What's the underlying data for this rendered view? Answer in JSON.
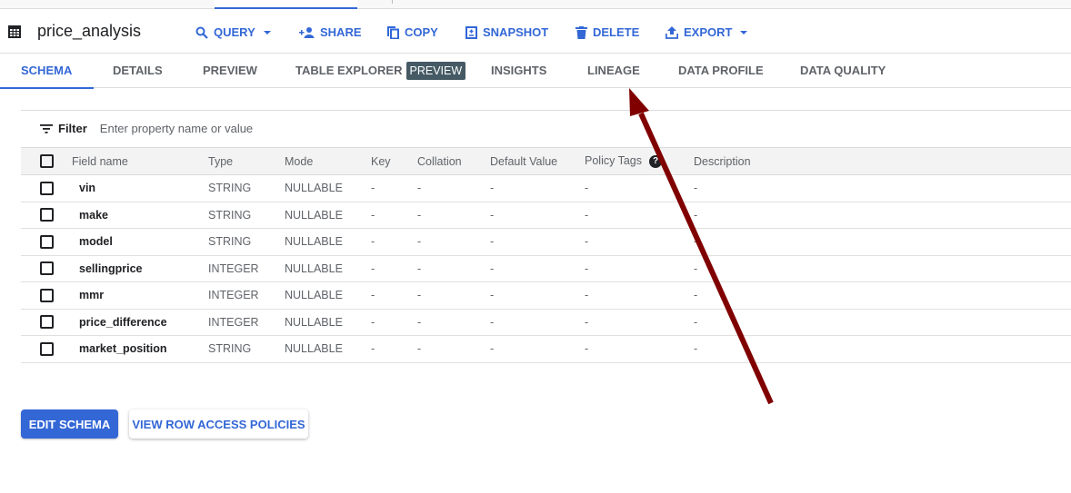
{
  "header": {
    "title": "price_analysis",
    "table_icon": "table-icon"
  },
  "toolbar": {
    "actions": [
      {
        "label": "QUERY",
        "icon": "search-icon",
        "dropdown": true
      },
      {
        "label": "SHARE",
        "icon": "person-add-icon",
        "dropdown": false
      },
      {
        "label": "COPY",
        "icon": "copy-icon",
        "dropdown": false
      },
      {
        "label": "SNAPSHOT",
        "icon": "snapshot-icon",
        "dropdown": false
      },
      {
        "label": "DELETE",
        "icon": "trash-icon",
        "dropdown": false
      },
      {
        "label": "EXPORT",
        "icon": "upload-icon",
        "dropdown": true
      }
    ]
  },
  "tabs": [
    {
      "label": "SCHEMA",
      "active": true
    },
    {
      "label": "DETAILS"
    },
    {
      "label": "PREVIEW"
    },
    {
      "label": "TABLE EXPLORER",
      "badge": "PREVIEW"
    },
    {
      "label": "INSIGHTS"
    },
    {
      "label": "LINEAGE"
    },
    {
      "label": "DATA PROFILE"
    },
    {
      "label": "DATA QUALITY"
    }
  ],
  "filter": {
    "label": "Filter",
    "placeholder": "Enter property name or value"
  },
  "schema_table": {
    "columns": [
      "Field name",
      "Type",
      "Mode",
      "Key",
      "Collation",
      "Default Value",
      "Policy Tags",
      "Description"
    ],
    "rows": [
      {
        "name": "vin",
        "type": "STRING",
        "mode": "NULLABLE",
        "key": "-",
        "collation": "-",
        "default": "-",
        "policy": "-",
        "description": "-"
      },
      {
        "name": "make",
        "type": "STRING",
        "mode": "NULLABLE",
        "key": "-",
        "collation": "-",
        "default": "-",
        "policy": "-",
        "description": "-"
      },
      {
        "name": "model",
        "type": "STRING",
        "mode": "NULLABLE",
        "key": "-",
        "collation": "-",
        "default": "-",
        "policy": "-",
        "description": "-"
      },
      {
        "name": "sellingprice",
        "type": "INTEGER",
        "mode": "NULLABLE",
        "key": "-",
        "collation": "-",
        "default": "-",
        "policy": "-",
        "description": "-"
      },
      {
        "name": "mmr",
        "type": "INTEGER",
        "mode": "NULLABLE",
        "key": "-",
        "collation": "-",
        "default": "-",
        "policy": "-",
        "description": "-"
      },
      {
        "name": "price_difference",
        "type": "INTEGER",
        "mode": "NULLABLE",
        "key": "-",
        "collation": "-",
        "default": "-",
        "policy": "-",
        "description": "-"
      },
      {
        "name": "market_position",
        "type": "STRING",
        "mode": "NULLABLE",
        "key": "-",
        "collation": "-",
        "default": "-",
        "policy": "-",
        "description": "-"
      }
    ]
  },
  "buttons": {
    "edit_schema": "EDIT SCHEMA",
    "view_row_access": "VIEW ROW ACCESS POLICIES"
  },
  "colors": {
    "accent": "#3367d6",
    "annotation_arrow": "#800000",
    "badge_bg": "#455a64"
  }
}
